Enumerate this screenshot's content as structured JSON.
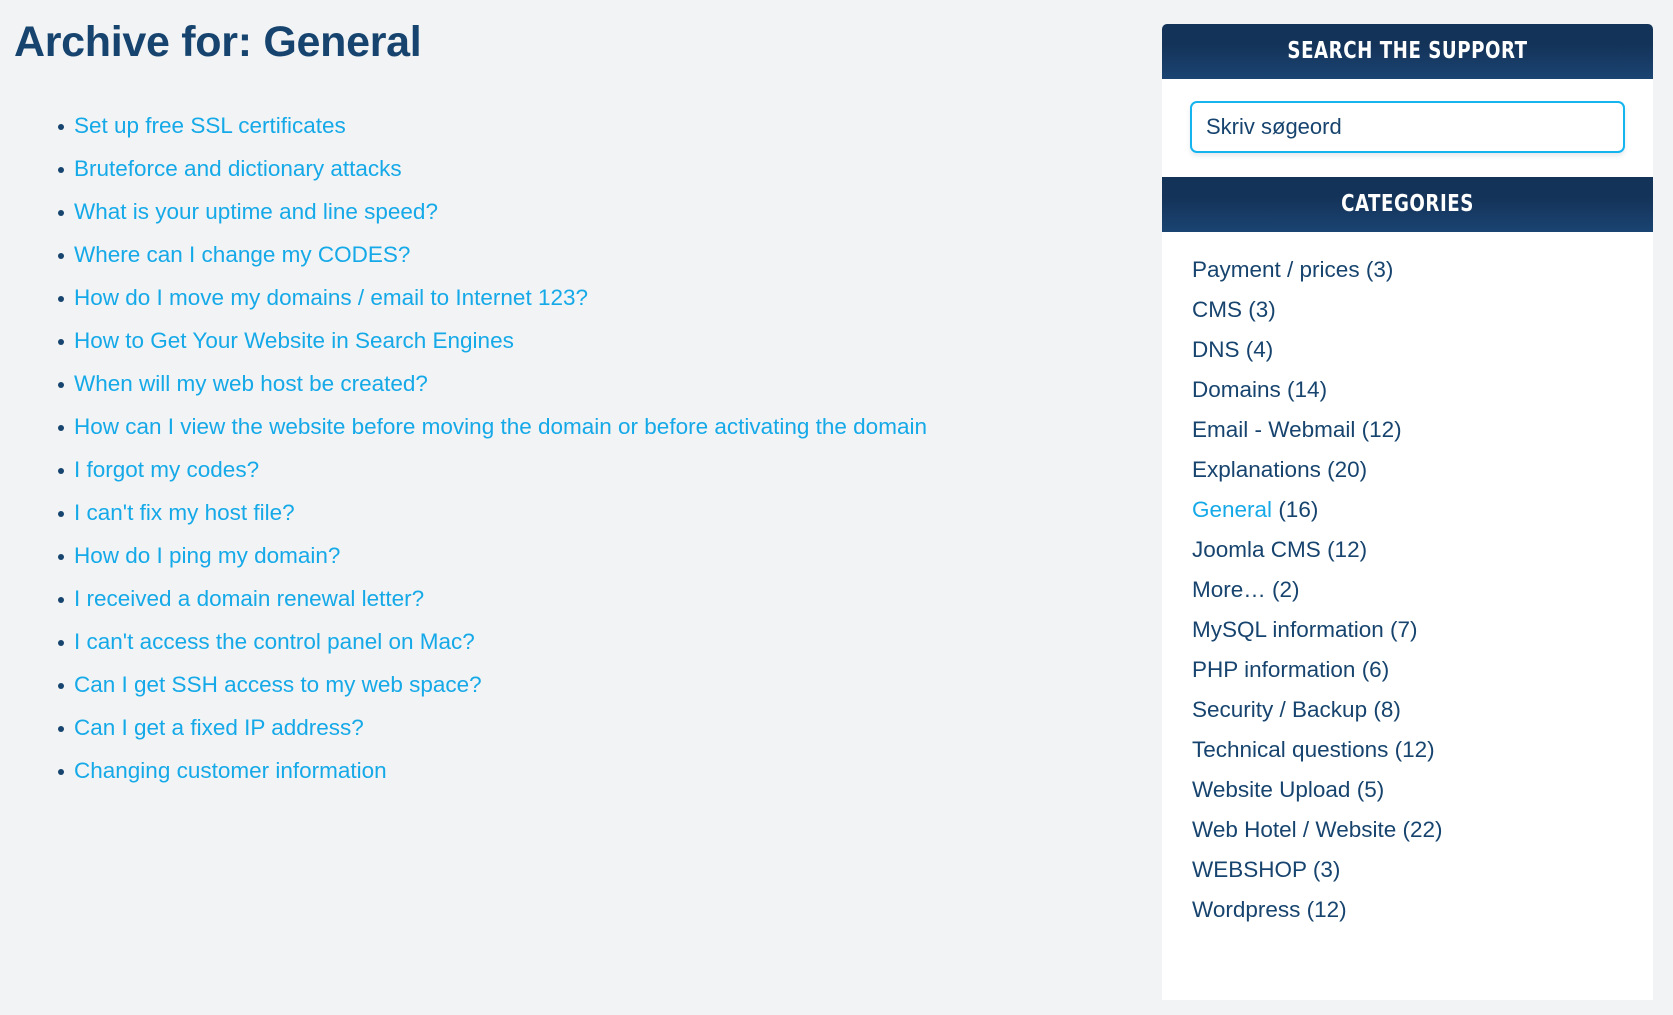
{
  "page": {
    "title": "Archive for: General",
    "background_color": "#f1f3f5",
    "navy": "#17446e",
    "cyan": "#15a9e8"
  },
  "archive": {
    "items": [
      {
        "label": "Set up free SSL certificates"
      },
      {
        "label": "Bruteforce and dictionary attacks"
      },
      {
        "label": "What is your uptime and line speed?"
      },
      {
        "label": "Where can I change my CODES?"
      },
      {
        "label": "How do I move my domains / email to Internet 123?"
      },
      {
        "label": "How to Get Your Website in Search Engines"
      },
      {
        "label": "When will my web host be created?"
      },
      {
        "label": "How can I view the website before moving the domain or before activating the domain"
      },
      {
        "label": "I forgot my codes?"
      },
      {
        "label": "I can't fix my host file?"
      },
      {
        "label": "How do I ping my domain?"
      },
      {
        "label": "I received a domain renewal letter?"
      },
      {
        "label": "I can't access the control panel on Mac?"
      },
      {
        "label": "Can I get SSH access to my web space?"
      },
      {
        "label": "Can I get a fixed IP address?"
      },
      {
        "label": "Changing customer information"
      }
    ]
  },
  "search_widget": {
    "header": "SEARCH THE SUPPORT",
    "input_value": "",
    "placeholder": "Skriv søgeord"
  },
  "categories_widget": {
    "header": "CATEGORIES",
    "items": [
      {
        "label": "Payment / prices",
        "count": "(3)",
        "active": false
      },
      {
        "label": "CMS",
        "count": "(3)",
        "active": false
      },
      {
        "label": "DNS",
        "count": "(4)",
        "active": false
      },
      {
        "label": "Domains",
        "count": "(14)",
        "active": false
      },
      {
        "label": "Email - Webmail",
        "count": "(12)",
        "active": false
      },
      {
        "label": "Explanations",
        "count": "(20)",
        "active": false
      },
      {
        "label": "General",
        "count": "(16)",
        "active": true
      },
      {
        "label": "Joomla CMS",
        "count": "(12)",
        "active": false
      },
      {
        "label": "More…",
        "count": "(2)",
        "active": false
      },
      {
        "label": "MySQL information",
        "count": "(7)",
        "active": false
      },
      {
        "label": "PHP information",
        "count": "(6)",
        "active": false
      },
      {
        "label": "Security / Backup",
        "count": "(8)",
        "active": false
      },
      {
        "label": "Technical questions",
        "count": "(12)",
        "active": false
      },
      {
        "label": "Website Upload",
        "count": "(5)",
        "active": false
      },
      {
        "label": "Web Hotel / Website",
        "count": "(22)",
        "active": false
      },
      {
        "label": "WEBSHOP",
        "count": "(3)",
        "active": false
      },
      {
        "label": "Wordpress",
        "count": "(12)",
        "active": false
      }
    ]
  }
}
